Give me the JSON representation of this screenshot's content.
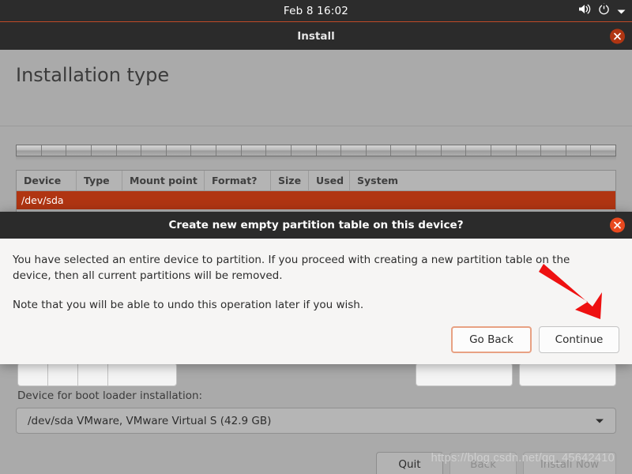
{
  "top_panel": {
    "clock": "Feb 8  16:02",
    "indicators": [
      "volume-icon",
      "power-icon",
      "chevron-down-icon"
    ]
  },
  "window": {
    "title": "Install",
    "close_label": "×"
  },
  "page": {
    "heading": "Installation type"
  },
  "partition_table": {
    "headers": [
      "Device",
      "Type",
      "Mount point",
      "Format?",
      "Size",
      "Used",
      "System"
    ],
    "rows": [
      {
        "device": "/dev/sda",
        "type": "",
        "mount_point": "",
        "format": "",
        "size": "",
        "used": "",
        "system": "",
        "selected": true
      }
    ]
  },
  "bootloader": {
    "label": "Device for boot loader installation:",
    "selected": "/dev/sda VMware, VMware Virtual S (42.9 GB)",
    "arrow_icon": "chevron-down-icon"
  },
  "bottom_actions": [
    {
      "label": "Quit",
      "disabled": false
    },
    {
      "label": "Back",
      "disabled": true
    },
    {
      "label": "Install Now",
      "disabled": true
    }
  ],
  "dialog": {
    "title": "Create new empty partition table on this device?",
    "close_label": "×",
    "paragraph_1": "You have selected an entire device to partition. If you proceed with creating a new partition table on the device, then all current partitions will be removed.",
    "paragraph_2": "Note that you will be able to undo this operation later if you wish.",
    "buttons": [
      {
        "label": "Go Back",
        "focused": true
      },
      {
        "label": "Continue",
        "focused": false
      }
    ]
  },
  "annotation": {
    "arrow_icon": "red-arrow-icon",
    "color": "#ee1111",
    "points_to": "Continue"
  },
  "watermark": {
    "text": "https://blog.csdn.net/qq_45642410"
  },
  "colors": {
    "panel_bg": "#2c2c2c",
    "window_bg": "#aaaaaa",
    "selection": "#b03512",
    "dialog_bg": "#f6f5f4",
    "focus_border": "#e8a183",
    "close_button": "#e8491f"
  }
}
